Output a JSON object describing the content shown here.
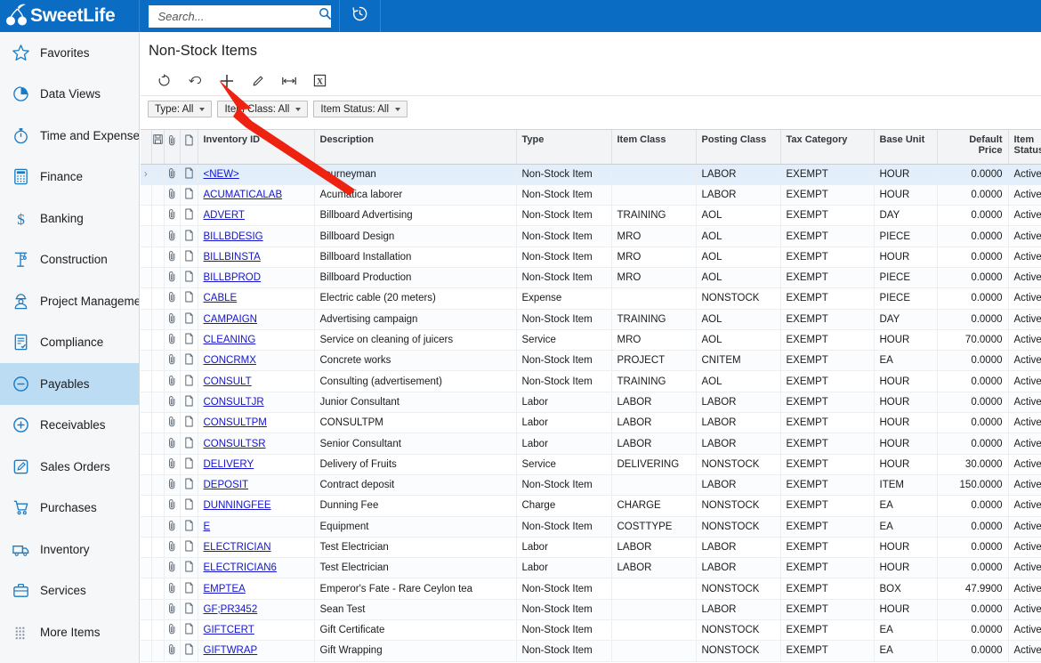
{
  "brand": {
    "name": "SweetLife",
    "logo_icon": "cherry-logo-icon",
    "accent": "#0b6cc4"
  },
  "topbar": {
    "search": {
      "placeholder": "Search...",
      "value": "",
      "icon": "search-icon"
    },
    "history_icon": "history-clock-icon"
  },
  "sidebar": {
    "items": [
      {
        "label": "Favorites",
        "icon": "star-icon",
        "active": false
      },
      {
        "label": "Data Views",
        "icon": "pie-chart-icon",
        "active": false
      },
      {
        "label": "Time and Expenses",
        "icon": "stopwatch-icon",
        "active": false
      },
      {
        "label": "Finance",
        "icon": "calculator-icon",
        "active": false
      },
      {
        "label": "Banking",
        "icon": "dollar-icon",
        "active": false
      },
      {
        "label": "Construction",
        "icon": "crane-icon",
        "active": false
      },
      {
        "label": "Project Management",
        "icon": "worker-icon",
        "active": false
      },
      {
        "label": "Compliance",
        "icon": "checklist-icon",
        "active": false
      },
      {
        "label": "Payables",
        "icon": "minus-circle-icon",
        "active": true
      },
      {
        "label": "Receivables",
        "icon": "plus-circle-icon",
        "active": false
      },
      {
        "label": "Sales Orders",
        "icon": "pencil-box-icon",
        "active": false
      },
      {
        "label": "Purchases",
        "icon": "cart-icon",
        "active": false
      },
      {
        "label": "Inventory",
        "icon": "truck-icon",
        "active": false
      },
      {
        "label": "Services",
        "icon": "briefcase-icon",
        "active": false
      },
      {
        "label": "More Items",
        "icon": "grid-dots-icon",
        "active": false
      }
    ]
  },
  "page": {
    "title": "Non-Stock Items"
  },
  "toolbar": {
    "buttons": [
      {
        "name": "refresh-button",
        "icon": "refresh-icon"
      },
      {
        "name": "undo-button",
        "icon": "undo-arrow-icon"
      },
      {
        "name": "add-new-button",
        "icon": "plus-icon"
      },
      {
        "name": "edit-button",
        "icon": "pencil-icon"
      },
      {
        "name": "fit-columns-button",
        "icon": "fit-width-icon"
      },
      {
        "name": "export-excel-button",
        "icon": "excel-icon"
      }
    ]
  },
  "filters": [
    {
      "label": "Type: All"
    },
    {
      "label": "Item Class: All"
    },
    {
      "label": "Item Status: All"
    }
  ],
  "grid": {
    "columns": [
      {
        "key": "sel",
        "label": "",
        "icon": "",
        "align": "left"
      },
      {
        "key": "save",
        "label": "",
        "icon": "save-icon",
        "align": "center"
      },
      {
        "key": "clip",
        "label": "",
        "icon": "paperclip-icon",
        "align": "center"
      },
      {
        "key": "note",
        "label": "",
        "icon": "note-icon",
        "align": "center"
      },
      {
        "key": "id",
        "label": "Inventory ID",
        "icon": "",
        "align": "left"
      },
      {
        "key": "desc",
        "label": "Description",
        "icon": "",
        "align": "left"
      },
      {
        "key": "type",
        "label": "Type",
        "icon": "",
        "align": "left"
      },
      {
        "key": "class",
        "label": "Item Class",
        "icon": "",
        "align": "left"
      },
      {
        "key": "post",
        "label": "Posting Class",
        "icon": "",
        "align": "left"
      },
      {
        "key": "tax",
        "label": "Tax Category",
        "icon": "",
        "align": "left"
      },
      {
        "key": "base",
        "label": "Base Unit",
        "icon": "",
        "align": "left"
      },
      {
        "key": "price",
        "label": "Default Price",
        "icon": "",
        "align": "right"
      },
      {
        "key": "stat",
        "label": "Item Status",
        "icon": "",
        "align": "left"
      }
    ],
    "rows": [
      {
        "id": "<NEW>",
        "desc": "Journeyman",
        "type": "Non-Stock Item",
        "class": "",
        "post": "LABOR",
        "tax": "EXEMPT",
        "base": "HOUR",
        "price": "0.0000",
        "stat": "Active",
        "selected": true
      },
      {
        "id": "ACUMATICALAB",
        "desc": "Acumatica laborer",
        "type": "Non-Stock Item",
        "class": "",
        "post": "LABOR",
        "tax": "EXEMPT",
        "base": "HOUR",
        "price": "0.0000",
        "stat": "Active",
        "selected": false
      },
      {
        "id": "ADVERT",
        "desc": "Billboard Advertising",
        "type": "Non-Stock Item",
        "class": "TRAINING",
        "post": "AOL",
        "tax": "EXEMPT",
        "base": "DAY",
        "price": "0.0000",
        "stat": "Active",
        "selected": false
      },
      {
        "id": "BILLBDESIG",
        "desc": "Billboard Design",
        "type": "Non-Stock Item",
        "class": "MRO",
        "post": "AOL",
        "tax": "EXEMPT",
        "base": "PIECE",
        "price": "0.0000",
        "stat": "Active",
        "selected": false
      },
      {
        "id": "BILLBINSTA",
        "desc": "Billboard Installation",
        "type": "Non-Stock Item",
        "class": "MRO",
        "post": "AOL",
        "tax": "EXEMPT",
        "base": "HOUR",
        "price": "0.0000",
        "stat": "Active",
        "selected": false
      },
      {
        "id": "BILLBPROD",
        "desc": "Billboard Production",
        "type": "Non-Stock Item",
        "class": "MRO",
        "post": "AOL",
        "tax": "EXEMPT",
        "base": "PIECE",
        "price": "0.0000",
        "stat": "Active",
        "selected": false
      },
      {
        "id": "CABLE",
        "desc": "Electric cable (20 meters)",
        "type": "Expense",
        "class": "",
        "post": "NONSTOCK",
        "tax": "EXEMPT",
        "base": "PIECE",
        "price": "0.0000",
        "stat": "Active",
        "selected": false
      },
      {
        "id": "CAMPAIGN",
        "desc": "Advertising campaign",
        "type": "Non-Stock Item",
        "class": "TRAINING",
        "post": "AOL",
        "tax": "EXEMPT",
        "base": "DAY",
        "price": "0.0000",
        "stat": "Active",
        "selected": false
      },
      {
        "id": "CLEANING",
        "desc": "Service on cleaning of juicers",
        "type": "Service",
        "class": "MRO",
        "post": "AOL",
        "tax": "EXEMPT",
        "base": "HOUR",
        "price": "70.0000",
        "stat": "Active",
        "selected": false
      },
      {
        "id": "CONCRMX",
        "desc": "Concrete works",
        "type": "Non-Stock Item",
        "class": "PROJECT",
        "post": "CNITEM",
        "tax": "EXEMPT",
        "base": "EA",
        "price": "0.0000",
        "stat": "Active",
        "selected": false
      },
      {
        "id": "CONSULT",
        "desc": "Consulting (advertisement)",
        "type": "Non-Stock Item",
        "class": "TRAINING",
        "post": "AOL",
        "tax": "EXEMPT",
        "base": "HOUR",
        "price": "0.0000",
        "stat": "Active",
        "selected": false
      },
      {
        "id": "CONSULTJR",
        "desc": "Junior Consultant",
        "type": "Labor",
        "class": "LABOR",
        "post": "LABOR",
        "tax": "EXEMPT",
        "base": "HOUR",
        "price": "0.0000",
        "stat": "Active",
        "selected": false
      },
      {
        "id": "CONSULTPM",
        "desc": "CONSULTPM",
        "type": "Labor",
        "class": "LABOR",
        "post": "LABOR",
        "tax": "EXEMPT",
        "base": "HOUR",
        "price": "0.0000",
        "stat": "Active",
        "selected": false
      },
      {
        "id": "CONSULTSR",
        "desc": "Senior Consultant",
        "type": "Labor",
        "class": "LABOR",
        "post": "LABOR",
        "tax": "EXEMPT",
        "base": "HOUR",
        "price": "0.0000",
        "stat": "Active",
        "selected": false
      },
      {
        "id": "DELIVERY",
        "desc": "Delivery of Fruits",
        "type": "Service",
        "class": "DELIVERING",
        "post": "NONSTOCK",
        "tax": "EXEMPT",
        "base": "HOUR",
        "price": "30.0000",
        "stat": "Active",
        "selected": false
      },
      {
        "id": "DEPOSIT",
        "desc": "Contract deposit",
        "type": "Non-Stock Item",
        "class": "",
        "post": "LABOR",
        "tax": "EXEMPT",
        "base": "ITEM",
        "price": "150.0000",
        "stat": "Active",
        "selected": false
      },
      {
        "id": "DUNNINGFEE",
        "desc": "Dunning Fee",
        "type": "Charge",
        "class": "CHARGE",
        "post": "NONSTOCK",
        "tax": "EXEMPT",
        "base": "EA",
        "price": "0.0000",
        "stat": "Active",
        "selected": false
      },
      {
        "id": "E",
        "desc": "Equipment",
        "type": "Non-Stock Item",
        "class": "COSTTYPE",
        "post": "NONSTOCK",
        "tax": "EXEMPT",
        "base": "EA",
        "price": "0.0000",
        "stat": "Active",
        "selected": false
      },
      {
        "id": "ELECTRICIAN",
        "desc": "Test Electrician",
        "type": "Labor",
        "class": "LABOR",
        "post": "LABOR",
        "tax": "EXEMPT",
        "base": "HOUR",
        "price": "0.0000",
        "stat": "Active",
        "selected": false
      },
      {
        "id": "ELECTRICIAN6",
        "desc": "Test Electrician",
        "type": "Labor",
        "class": "LABOR",
        "post": "LABOR",
        "tax": "EXEMPT",
        "base": "HOUR",
        "price": "0.0000",
        "stat": "Active",
        "selected": false
      },
      {
        "id": "EMPTEA",
        "desc": "Emperor's Fate - Rare Ceylon tea",
        "type": "Non-Stock Item",
        "class": "",
        "post": "NONSTOCK",
        "tax": "EXEMPT",
        "base": "BOX",
        "price": "47.9900",
        "stat": "Active",
        "selected": false
      },
      {
        "id": "GF;PR3452",
        "desc": "Sean Test",
        "type": "Non-Stock Item",
        "class": "",
        "post": "LABOR",
        "tax": "EXEMPT",
        "base": "HOUR",
        "price": "0.0000",
        "stat": "Active",
        "selected": false
      },
      {
        "id": "GIFTCERT",
        "desc": "Gift Certificate",
        "type": "Non-Stock Item",
        "class": "",
        "post": "NONSTOCK",
        "tax": "EXEMPT",
        "base": "EA",
        "price": "0.0000",
        "stat": "Active",
        "selected": false
      },
      {
        "id": "GIFTWRAP",
        "desc": "Gift Wrapping",
        "type": "Non-Stock Item",
        "class": "",
        "post": "NONSTOCK",
        "tax": "EXEMPT",
        "base": "EA",
        "price": "0.0000",
        "stat": "Active",
        "selected": false
      }
    ]
  },
  "annotation": {
    "arrow_color": "#ee2211",
    "points_to": "add-new-button"
  }
}
